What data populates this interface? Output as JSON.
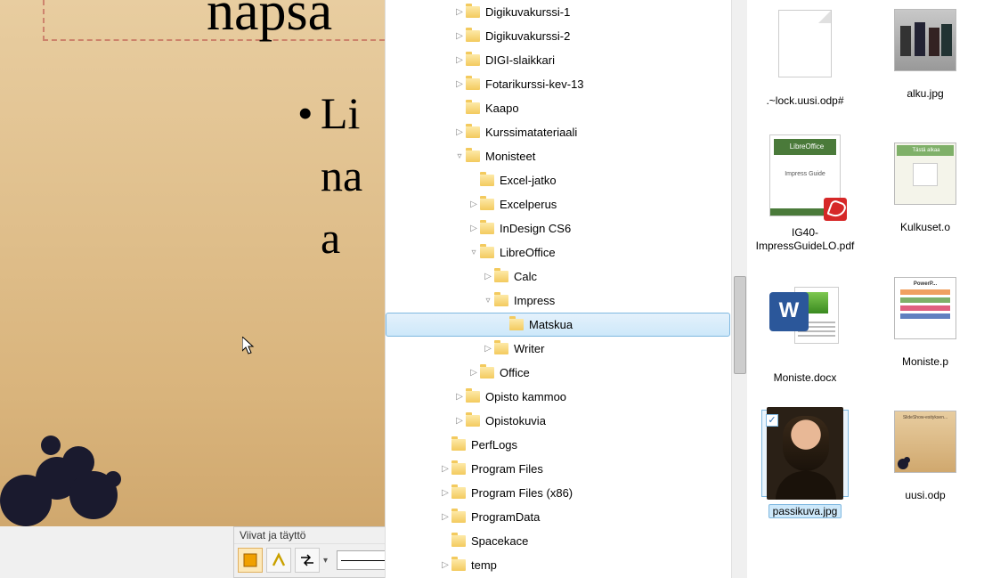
{
  "slide": {
    "title_fragment": "napsa",
    "body_line1": "Li",
    "body_line2": "na",
    "body_line3": "a"
  },
  "toolbar": {
    "title": "Viivat ja täyttö"
  },
  "tree": {
    "items": [
      {
        "label": "Digikuvakurssi-1",
        "indent": 3,
        "exp": "▷"
      },
      {
        "label": "Digikuvakurssi-2",
        "indent": 3,
        "exp": "▷"
      },
      {
        "label": "DIGI-slaikkari",
        "indent": 3,
        "exp": "▷"
      },
      {
        "label": "Fotarikurssi-kev-13",
        "indent": 3,
        "exp": "▷"
      },
      {
        "label": "Kaapo",
        "indent": 3,
        "exp": ""
      },
      {
        "label": "Kurssimatateriaali",
        "indent": 3,
        "exp": "▷"
      },
      {
        "label": "Monisteet",
        "indent": 3,
        "exp": "▿"
      },
      {
        "label": "Excel-jatko",
        "indent": 4,
        "exp": ""
      },
      {
        "label": "Excelperus",
        "indent": 4,
        "exp": "▷"
      },
      {
        "label": "InDesign CS6",
        "indent": 4,
        "exp": "▷"
      },
      {
        "label": "LibreOffice",
        "indent": 4,
        "exp": "▿"
      },
      {
        "label": "Calc",
        "indent": 5,
        "exp": "▷"
      },
      {
        "label": "Impress",
        "indent": 5,
        "exp": "▿"
      },
      {
        "label": "Matskua",
        "indent": 6,
        "exp": "",
        "selected": true
      },
      {
        "label": "Writer",
        "indent": 5,
        "exp": "▷"
      },
      {
        "label": "Office",
        "indent": 4,
        "exp": "▷"
      },
      {
        "label": "Opisto kammoo",
        "indent": 3,
        "exp": "▷"
      },
      {
        "label": "Opistokuvia",
        "indent": 3,
        "exp": "▷"
      },
      {
        "label": "PerfLogs",
        "indent": 2,
        "exp": ""
      },
      {
        "label": "Program Files",
        "indent": 2,
        "exp": "▷"
      },
      {
        "label": "Program Files (x86)",
        "indent": 2,
        "exp": "▷"
      },
      {
        "label": "ProgramData",
        "indent": 2,
        "exp": "▷"
      },
      {
        "label": "Spacekace",
        "indent": 2,
        "exp": ""
      },
      {
        "label": "temp",
        "indent": 2,
        "exp": "▷"
      }
    ]
  },
  "files": {
    "col1": [
      {
        "name": ".~lock.uusi.odp#",
        "type": "blank"
      },
      {
        "name": "IG40-ImpressGuideLO.pdf",
        "type": "pdf"
      },
      {
        "name": "Moniste.docx",
        "type": "docx"
      },
      {
        "name": "passikuva.jpg",
        "type": "photo",
        "selected": true
      }
    ],
    "col2": [
      {
        "name": "alku.jpg",
        "type": "thumb-photo2"
      },
      {
        "name": "Kulkuset.o",
        "type": "thumb-green"
      },
      {
        "name": "Moniste.p",
        "type": "thumb-pp"
      },
      {
        "name": "uusi.odp",
        "type": "thumb-brown"
      }
    ]
  }
}
